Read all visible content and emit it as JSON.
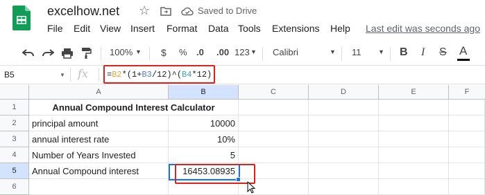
{
  "app": {
    "doc_title": "excelhow.net",
    "saved_status": "Saved to Drive",
    "last_edit": "Last edit was seconds ago",
    "menu": [
      "File",
      "Edit",
      "View",
      "Insert",
      "Format",
      "Data",
      "Tools",
      "Extensions",
      "Help"
    ]
  },
  "toolbar": {
    "zoom": "100%",
    "currency": "$",
    "percent": "%",
    "dec_decrease": ".0",
    "dec_increase": ".00",
    "more_formats": "123",
    "font": "Calibri",
    "font_size": "11",
    "bold": "B",
    "italic": "I",
    "strike": "S",
    "text_color": "A"
  },
  "formula_bar": {
    "name_box": "B5",
    "fx": "fx",
    "formula_parts": [
      "=",
      "B2",
      "*(1+",
      "B3",
      "/12)^(",
      "B4",
      "*12)"
    ]
  },
  "grid": {
    "columns": [
      "A",
      "B",
      "C",
      "D",
      "E",
      "F"
    ],
    "rows": [
      "1",
      "2",
      "3",
      "4",
      "5",
      "6"
    ],
    "cells": {
      "A1": "Annual Compound Interest Calculator",
      "A2": "principal amount",
      "B2": "10000",
      "A3": "annual interest rate",
      "B3": "10%",
      "A4": "Number of Years Invested",
      "B4": "5",
      "A5": "Annual Compound interest",
      "B5": "16453.08935"
    }
  },
  "colors": {
    "highlight_red": "#e0201a",
    "selection_blue": "#1a73e8",
    "ref_b2": "#e8a23a",
    "ref_b3": "#4f7ec1",
    "ref_b4": "#37a3b0"
  }
}
